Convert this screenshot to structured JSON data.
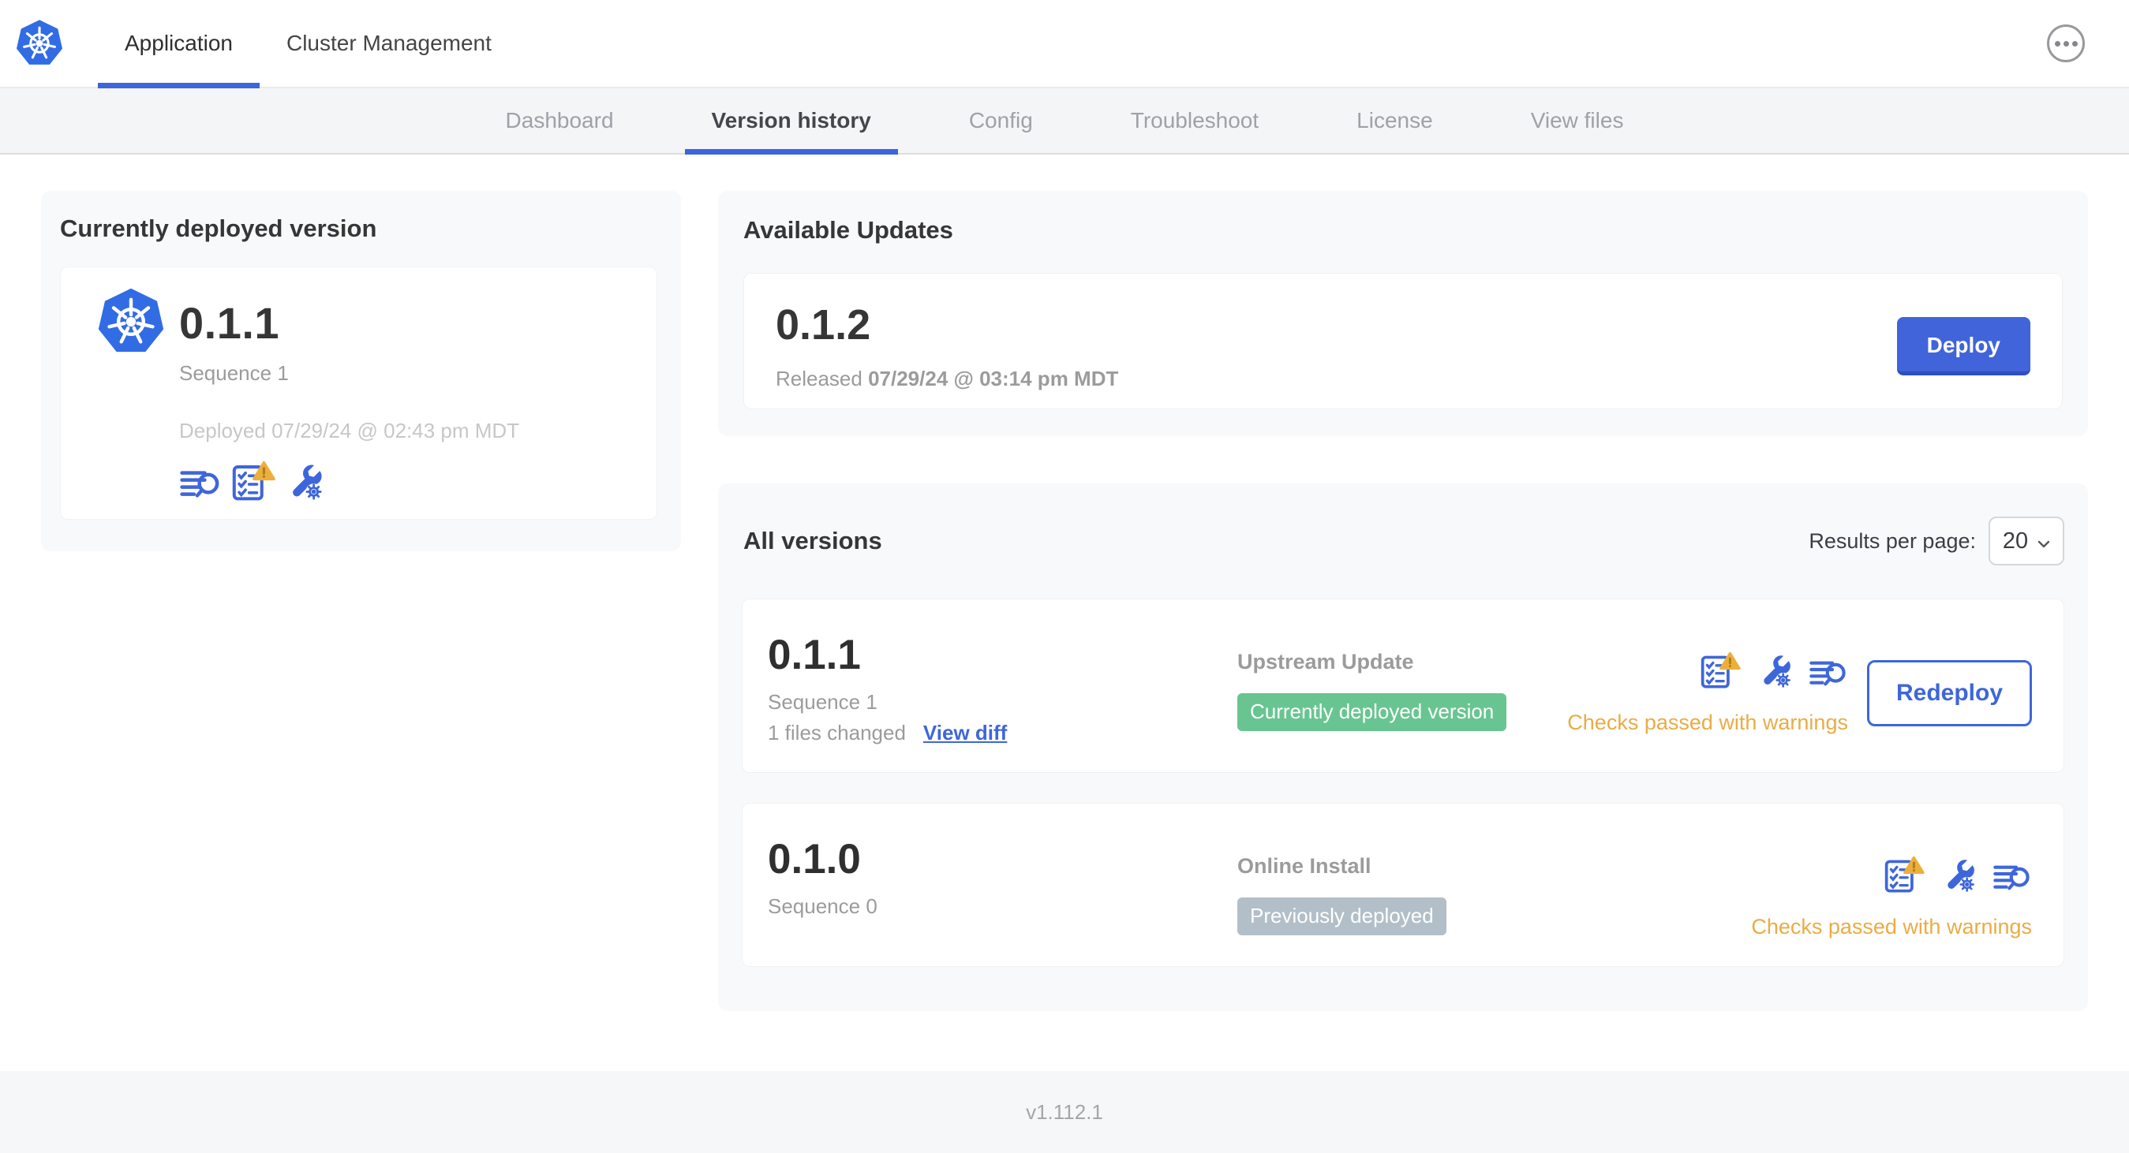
{
  "header": {
    "tabs": [
      {
        "label": "Application"
      },
      {
        "label": "Cluster Management"
      }
    ]
  },
  "subnav": {
    "tabs": [
      {
        "label": "Dashboard"
      },
      {
        "label": "Version history"
      },
      {
        "label": "Config"
      },
      {
        "label": "Troubleshoot"
      },
      {
        "label": "License"
      },
      {
        "label": "View files"
      }
    ]
  },
  "current_version_card": {
    "title": "Currently deployed version",
    "version": "0.1.1",
    "sequence": "Sequence 1",
    "deployed": "Deployed 07/29/24 @ 02:43 pm MDT"
  },
  "available_updates": {
    "title": "Available Updates",
    "version": "0.1.2",
    "released_prefix": "Released ",
    "released_date": "07/29/24 @ 03:14 pm MDT",
    "deploy_label": "Deploy"
  },
  "all_versions": {
    "title": "All versions",
    "results_per_page_label": "Results per page:",
    "results_per_page_value": "20",
    "rows": [
      {
        "version": "0.1.1",
        "sequence": "Sequence 1",
        "files_changed": "1 files changed",
        "view_diff_label": "View diff",
        "source": "Upstream Update",
        "badge": "Currently deployed version",
        "status": "Checks passed with warnings",
        "action_label": "Redeploy"
      },
      {
        "version": "0.1.0",
        "sequence": "Sequence 0",
        "source": "Online Install",
        "badge": "Previously deployed",
        "status": "Checks passed with warnings"
      }
    ]
  },
  "footer": {
    "app_version": "v1.112.1"
  },
  "colors": {
    "accent_blue": "#3E66DB",
    "logo_blue": "#326CE5",
    "success_green": "#68C591",
    "muted_badge_gray": "#B2BFC8",
    "warning_amber": "#EAAC45",
    "warning_triangle": "#EDAF3C"
  }
}
